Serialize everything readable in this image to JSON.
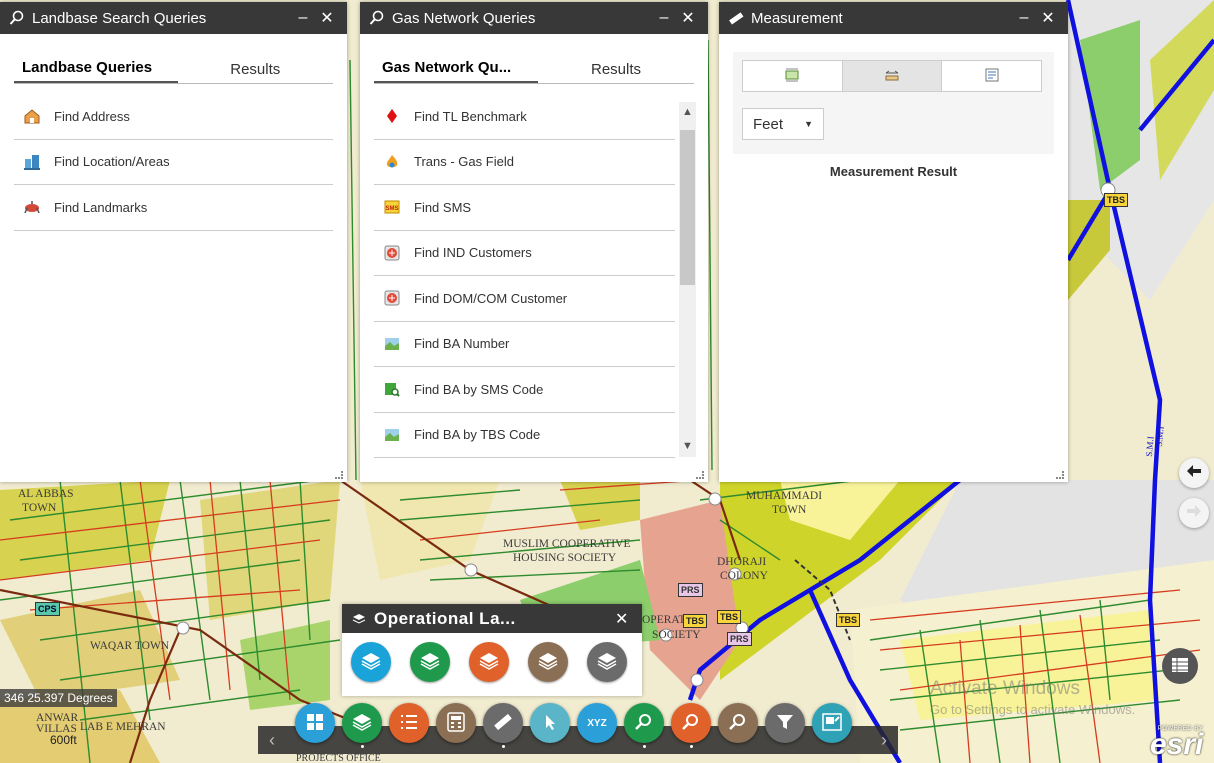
{
  "map": {
    "labels": [
      "AL ABBAS",
      "TOWN",
      "MUSLIM COOPERATIVE",
      "HOUSING SOCIETY",
      "MUHAMMADI",
      "TOWN",
      "DHORAJI",
      "COLONY",
      "WAQAR TOWN",
      "ANWAR",
      "VILLAS",
      "LAB E MEHRAN",
      "OPERATIVE",
      "SOCIETY",
      "S.M.I",
      "S.M.I",
      "PROJECTS OFFICE"
    ],
    "badges": [
      "TBS",
      "TBS",
      "TBS",
      "TBS",
      "PRS",
      "PRS",
      "CPS"
    ],
    "coordinate_readout": "346 25.397 Degrees",
    "scale_label": "600ft",
    "watermark_line1": "Activate Windows",
    "watermark_line2": "Go to Settings to activate Windows.",
    "attribution_top": "POWERED BY",
    "attribution_logo": "esri"
  },
  "landbase_panel": {
    "title": "Landbase Search Queries",
    "minimize": "–",
    "close": "✕",
    "tabs": [
      "Landbase Queries",
      "Results"
    ],
    "items": [
      {
        "label": "Find Address",
        "icon": "house-icon"
      },
      {
        "label": "Find Location/Areas",
        "icon": "buildings-icon"
      },
      {
        "label": "Find Landmarks",
        "icon": "landmark-icon"
      }
    ]
  },
  "gas_panel": {
    "title": "Gas Network Queries",
    "minimize": "–",
    "close": "✕",
    "tabs": [
      "Gas Network Qu...",
      "Results"
    ],
    "items": [
      {
        "label": "Find TL Benchmark",
        "icon": "red-diamond-icon"
      },
      {
        "label": "Trans - Gas Field",
        "icon": "flame-icon"
      },
      {
        "label": "Find SMS",
        "icon": "sms-icon"
      },
      {
        "label": "Find IND Customers",
        "icon": "meter-icon"
      },
      {
        "label": "Find DOM/COM Customer",
        "icon": "meter-icon"
      },
      {
        "label": "Find BA Number",
        "icon": "map-icon"
      },
      {
        "label": "Find BA by SMS Code",
        "icon": "green-search-icon"
      },
      {
        "label": "Find BA by TBS Code",
        "icon": "map-icon"
      }
    ]
  },
  "measurement_panel": {
    "title": "Measurement",
    "minimize": "–",
    "close": "✕",
    "tools": [
      "area-icon",
      "distance-icon",
      "location-icon"
    ],
    "unit": "Feet",
    "result_label": "Measurement Result"
  },
  "operational_layers": {
    "title": "Operational La...",
    "close": "✕",
    "layers": [
      {
        "icon": "layers-icon",
        "color": "#1aa3d9"
      },
      {
        "icon": "layers-icon",
        "color": "#1f9a4c"
      },
      {
        "icon": "layers-icon",
        "color": "#e0622a"
      },
      {
        "icon": "layers-icon",
        "color": "#8a6f55"
      },
      {
        "icon": "layers-icon",
        "color": "#6b6b6b"
      }
    ]
  },
  "toolbar": {
    "prev": "‹",
    "next": "›",
    "tools": [
      {
        "icon": "grid-icon",
        "color": "#2a9fd8"
      },
      {
        "icon": "layers-icon",
        "color": "#1f9a4c"
      },
      {
        "icon": "list-icon",
        "color": "#e0622a"
      },
      {
        "icon": "calculator-icon",
        "color": "#8a6f55"
      },
      {
        "icon": "ruler-icon",
        "color": "#6b6b6b"
      },
      {
        "icon": "pointer-icon",
        "color": "#5ab5c9"
      },
      {
        "icon": "xyz-icon",
        "color": "#2a9fd8"
      },
      {
        "icon": "search-icon",
        "color": "#1f9a4c"
      },
      {
        "icon": "search-icon",
        "color": "#e0622a"
      },
      {
        "icon": "search-icon",
        "color": "#8a6f55"
      },
      {
        "icon": "filter-icon",
        "color": "#6b6b6b"
      },
      {
        "icon": "export-icon",
        "color": "#2fa3b5"
      }
    ],
    "xyz_text": "XYZ"
  },
  "side_nav": {
    "back": "🡐",
    "forward": "🡒"
  }
}
